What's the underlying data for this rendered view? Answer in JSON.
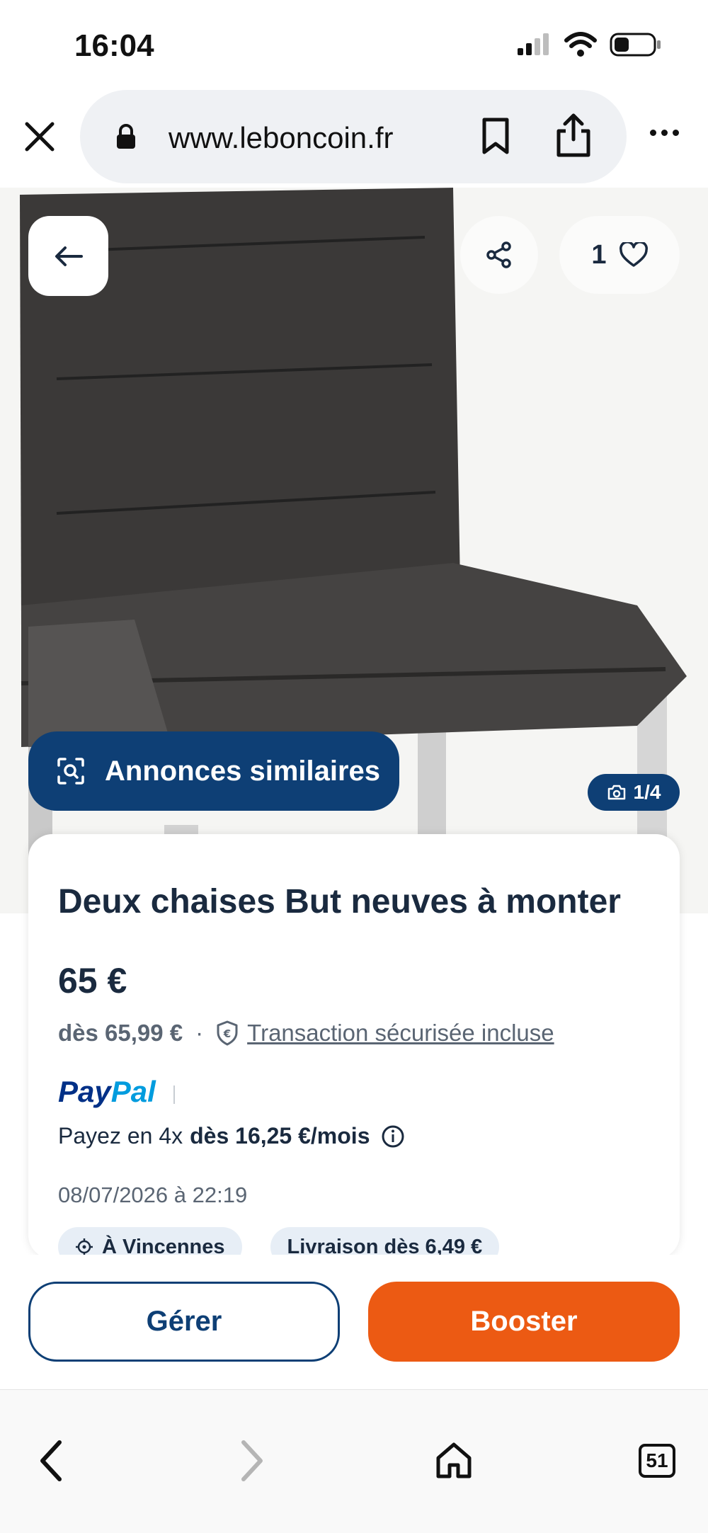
{
  "status_bar": {
    "time": "16:04"
  },
  "browser": {
    "url": "www.leboncoin.fr"
  },
  "hero": {
    "favorites_count": "1",
    "similar_label": "Annonces similaires",
    "photo_counter": "1/4"
  },
  "ad": {
    "title": "Deux chaises But neuves à monter",
    "price": "65 €",
    "price_from": "dès 65,99 €",
    "separator": "·",
    "secure_label": "Transaction sécurisée incluse",
    "paypal_pay": "Pay",
    "paypal_pal": "Pal",
    "paypal_text": "Payez en 4x",
    "paypal_amount": "dès 16,25 €/mois",
    "date": "08/07/2026 à 22:19",
    "tags": [
      {
        "label": "À Vincennes"
      },
      {
        "label": "Livraison dès 6,49 €"
      }
    ]
  },
  "actions": {
    "manage_label": "Gérer",
    "boost_label": "Booster"
  },
  "browser_nav": {
    "tabs_count": "51"
  },
  "colors": {
    "brand_blue": "#0e3f75",
    "boost_orange": "#ec5a13",
    "text_dark": "#1a2a3f"
  }
}
